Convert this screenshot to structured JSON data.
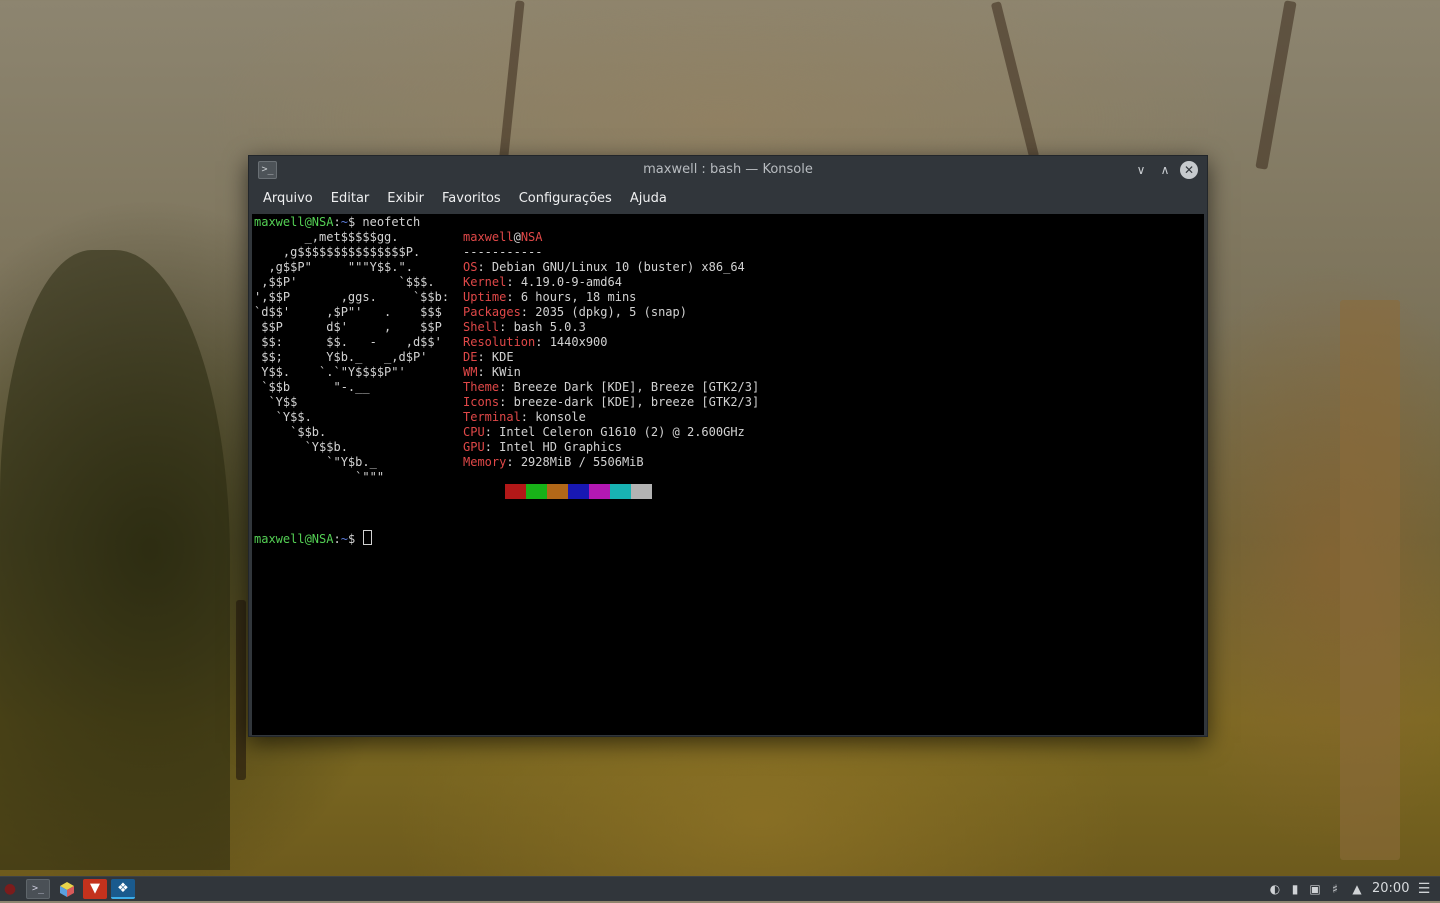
{
  "window": {
    "title": "maxwell : bash — Konsole",
    "menu": [
      "Arquivo",
      "Editar",
      "Exibir",
      "Favoritos",
      "Configurações",
      "Ajuda"
    ]
  },
  "terminal": {
    "prompt_user": "maxwell@NSA",
    "prompt_path": "~",
    "prompt_symbol": "$",
    "command": "neofetch",
    "ascii_art": [
      "       _,met$$$$$gg.",
      "    ,g$$$$$$$$$$$$$$$P.",
      "  ,g$$P\"     \"\"\"Y$$.\".",
      " ,$$P'              `$$$.",
      "',$$P       ,ggs.     `$$b:",
      "`d$$'     ,$P\"'   .    $$$",
      " $$P      d$'     ,    $$P",
      " $$:      $$.   -    ,d$$'",
      " $$;      Y$b._   _,d$P'",
      " Y$$.    `.`\"Y$$$$P\"'",
      " `$$b      \"-.__",
      "  `Y$$",
      "   `Y$$.",
      "     `$$b.",
      "       `Y$$b.",
      "          `\"Y$b._",
      "              `\"\"\""
    ],
    "info_user": "maxwell",
    "info_at": "@",
    "info_host": "NSA",
    "separator": "-----------",
    "info": [
      {
        "label": "OS",
        "value": "Debian GNU/Linux 10 (buster) x86_64"
      },
      {
        "label": "Kernel",
        "value": "4.19.0-9-amd64"
      },
      {
        "label": "Uptime",
        "value": "6 hours, 18 mins"
      },
      {
        "label": "Packages",
        "value": "2035 (dpkg), 5 (snap)"
      },
      {
        "label": "Shell",
        "value": "bash 5.0.3"
      },
      {
        "label": "Resolution",
        "value": "1440x900"
      },
      {
        "label": "DE",
        "value": "KDE"
      },
      {
        "label": "WM",
        "value": "KWin"
      },
      {
        "label": "Theme",
        "value": "Breeze Dark [KDE], Breeze [GTK2/3]"
      },
      {
        "label": "Icons",
        "value": "breeze-dark [KDE], breeze [GTK2/3]"
      },
      {
        "label": "Terminal",
        "value": "konsole"
      },
      {
        "label": "CPU",
        "value": "Intel Celeron G1610 (2) @ 2.600GHz"
      },
      {
        "label": "GPU",
        "value": "Intel HD Graphics"
      },
      {
        "label": "Memory",
        "value": "2928MiB / 5506MiB"
      }
    ],
    "palette": [
      "#000000",
      "#b21818",
      "#18b218",
      "#b26818",
      "#1818b2",
      "#b218b2",
      "#18b2b2",
      "#b2b2b2"
    ]
  },
  "taskbar": {
    "apps": [
      {
        "name": "konsole",
        "icon": "terminal-icon"
      },
      {
        "name": "glxgears",
        "icon": "cube-icon"
      },
      {
        "name": "brave",
        "icon": "brave-lion-icon"
      },
      {
        "name": "steam",
        "icon": "steam-icon"
      }
    ],
    "tray_icons": [
      "steam-tray-icon",
      "usb-icon",
      "network-icon",
      "volume-icon",
      "expand-tray-icon"
    ],
    "clock": "20:00"
  }
}
